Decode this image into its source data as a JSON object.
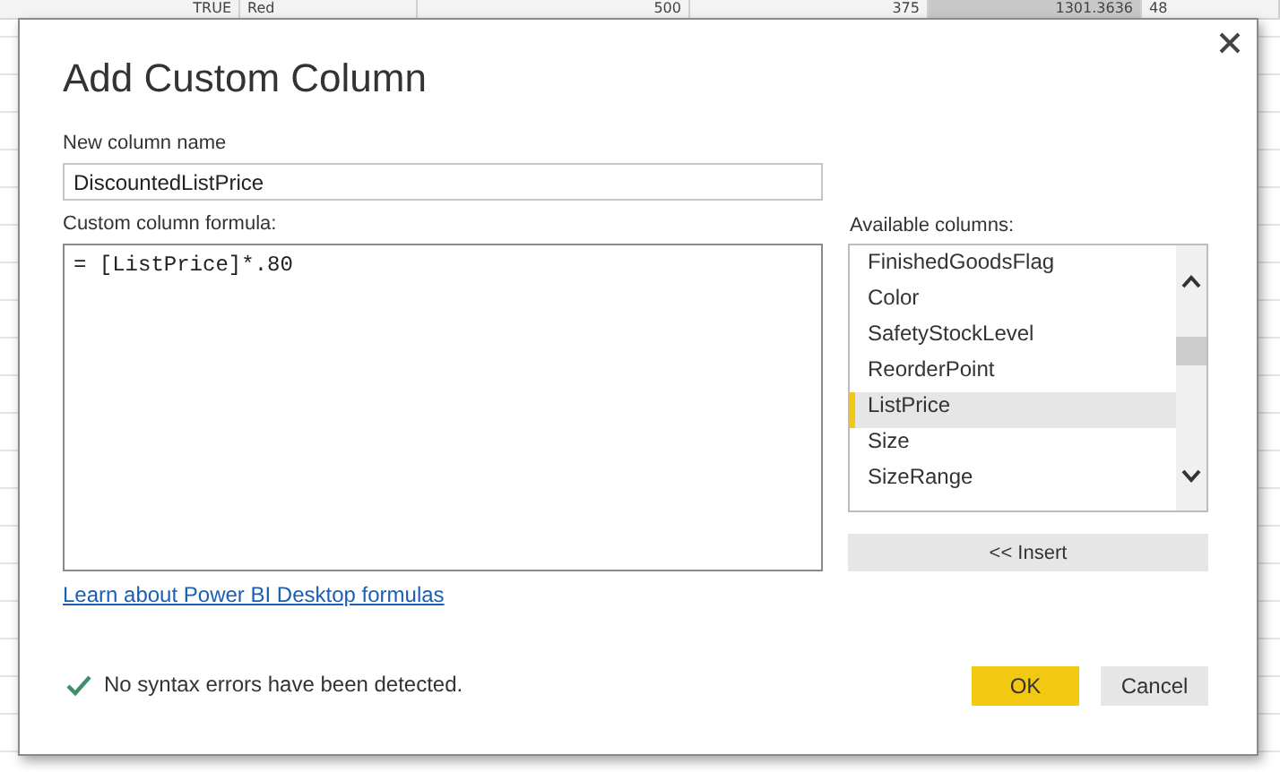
{
  "background_row": {
    "cells": [
      "TRUE",
      "Red",
      "500",
      "375",
      "1301.3636",
      "48"
    ]
  },
  "dialog": {
    "title": "Add Custom Column",
    "name_label": "New column name",
    "name_value": "DiscountedListPrice",
    "formula_label": "Custom column formula:",
    "formula_value": "= [ListPrice]*.80",
    "columns_label": "Available columns:",
    "columns": [
      {
        "label": "FinishedGoodsFlag",
        "selected": false
      },
      {
        "label": "Color",
        "selected": false
      },
      {
        "label": "SafetyStockLevel",
        "selected": false
      },
      {
        "label": "ReorderPoint",
        "selected": false
      },
      {
        "label": "ListPrice",
        "selected": true
      },
      {
        "label": "Size",
        "selected": false
      },
      {
        "label": "SizeRange",
        "selected": false
      }
    ],
    "insert_button": "<< Insert",
    "link": "Learn about Power BI Desktop formulas",
    "status": "No syntax errors have been detected.",
    "ok_button": "OK",
    "cancel_button": "Cancel"
  }
}
